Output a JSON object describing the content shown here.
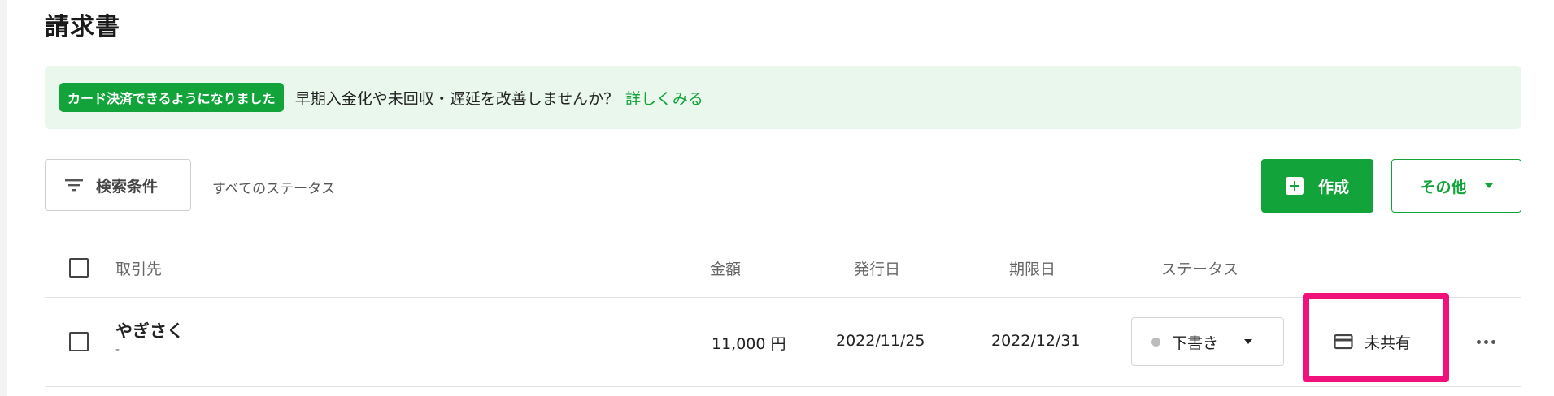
{
  "page": {
    "title": "請求書"
  },
  "banner": {
    "badge": "カード決済できるようになりました",
    "message": "早期入金化や未回収・遅延を改善しませんか？",
    "link": "詳しくみる"
  },
  "toolbar": {
    "search_label": "検索条件",
    "status_filter": "すべてのステータス",
    "create_label": "作成",
    "other_label": "その他"
  },
  "table": {
    "headers": {
      "client": "取引先",
      "amount": "金額",
      "issue_date": "発行日",
      "due_date": "期限日",
      "status": "ステータス"
    },
    "rows": [
      {
        "client_name": "やぎさく",
        "client_sub": "-",
        "amount": "11,000 円",
        "issue_date": "2022/11/25",
        "due_date": "2022/12/31",
        "status": "下書き",
        "share_status": "未共有"
      }
    ]
  },
  "colors": {
    "brand_green": "#12a33a",
    "banner_bg": "#e9f7ec",
    "highlight": "#f0127a",
    "draft_dot": "#bdbdbd"
  },
  "icons": {
    "search": "filter-lines-icon",
    "create": "plus-square-icon",
    "other": "caret-down-icon",
    "status": "caret-down-icon",
    "share": "credit-card-icon",
    "more": "more-horizontal-icon"
  }
}
